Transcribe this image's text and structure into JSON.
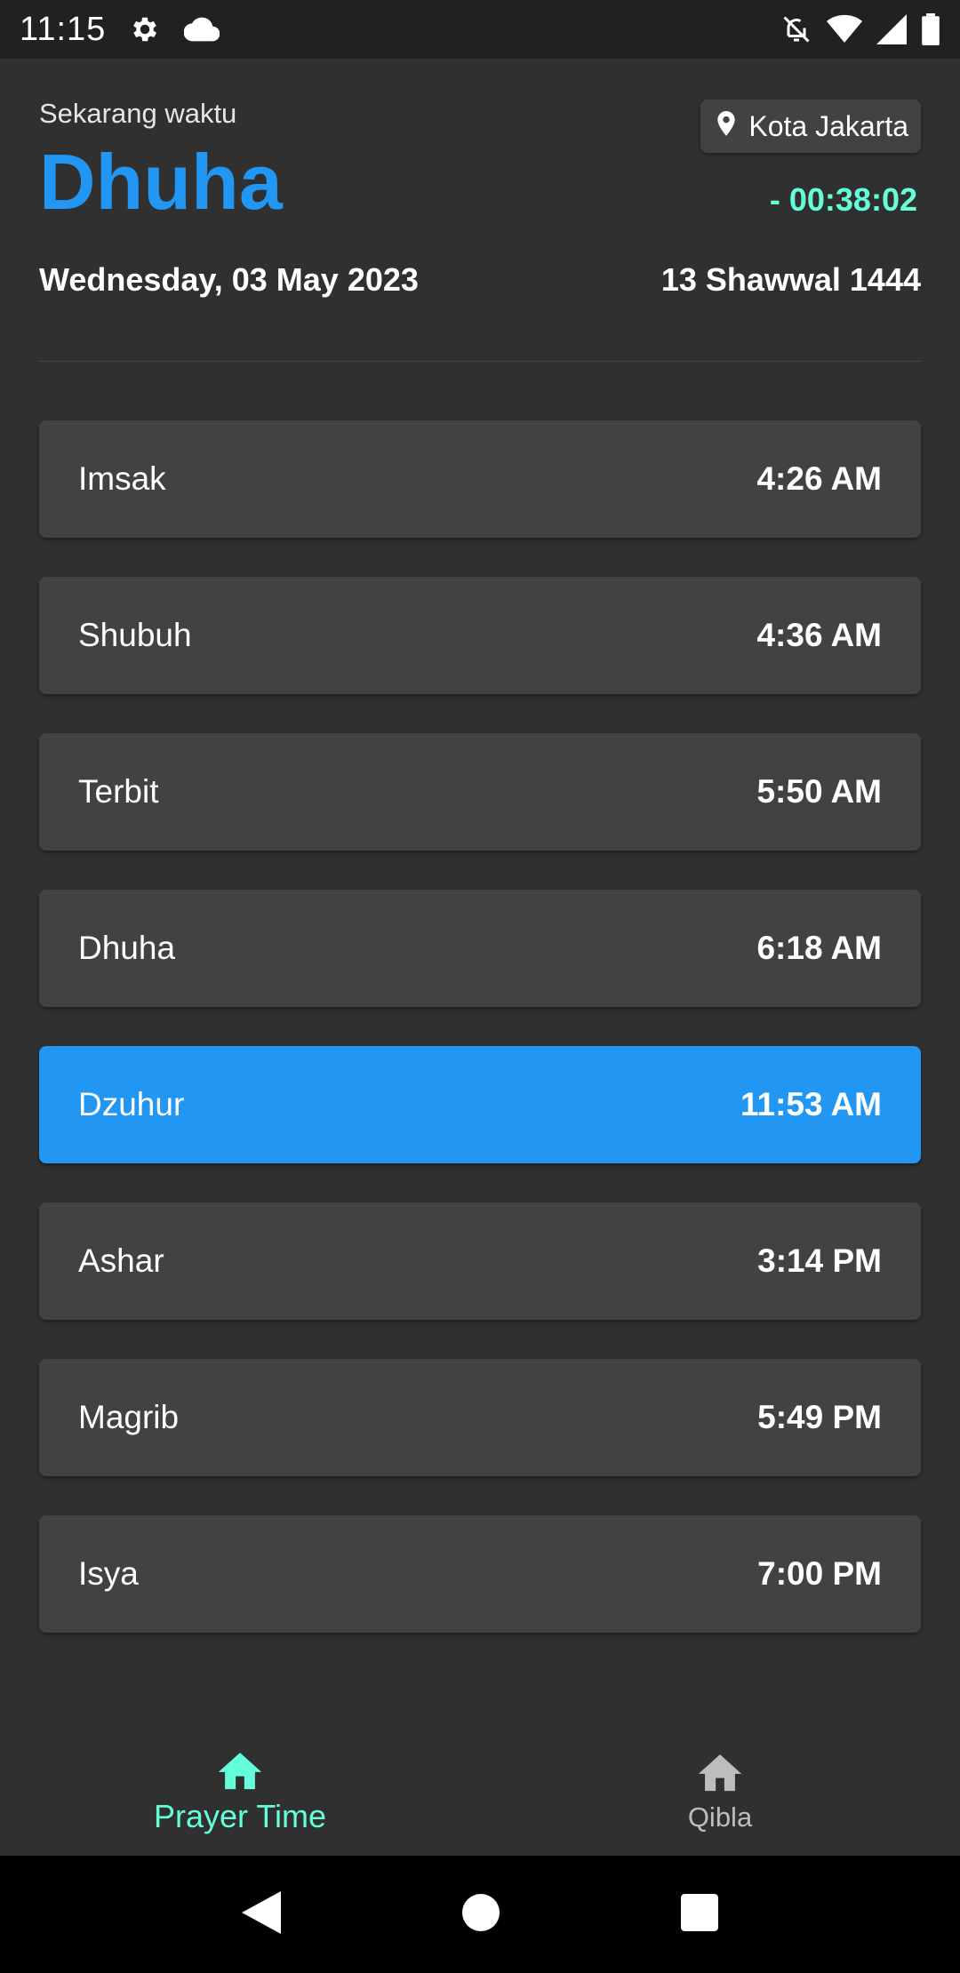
{
  "status_bar": {
    "time": "11:15",
    "icons": [
      "gear-icon",
      "cloud-icon",
      "bell-off-icon",
      "wifi-icon",
      "cell-signal-icon",
      "battery-icon"
    ]
  },
  "header": {
    "now_label": "Sekarang waktu",
    "current_prayer": "Dhuha",
    "location": "Kota Jakarta",
    "countdown": "- 00:38:02",
    "gregorian_date": "Wednesday, 03 May 2023",
    "hijri_date": "13 Shawwal 1444"
  },
  "prayers": [
    {
      "name": "Imsak",
      "time": "4:26 AM"
    },
    {
      "name": "Shubuh",
      "time": "4:36 AM"
    },
    {
      "name": "Terbit",
      "time": "5:50 AM"
    },
    {
      "name": "Dhuha",
      "time": "6:18 AM"
    },
    {
      "name": "Dzuhur",
      "time": "11:53 AM"
    },
    {
      "name": "Ashar",
      "time": "3:14 PM"
    },
    {
      "name": "Magrib",
      "time": "5:49 PM"
    },
    {
      "name": "Isya",
      "time": "7:00 PM"
    }
  ],
  "highlighted_prayer_index": 4,
  "bottom_nav": {
    "items": [
      {
        "label": "Prayer Time",
        "icon": "home-icon",
        "active": true
      },
      {
        "label": "Qibla",
        "icon": "home-icon",
        "active": false
      }
    ]
  },
  "colors": {
    "background": "#303030",
    "card": "#424242",
    "accent_blue": "#2196f3",
    "accent_teal": "#64ffda"
  }
}
